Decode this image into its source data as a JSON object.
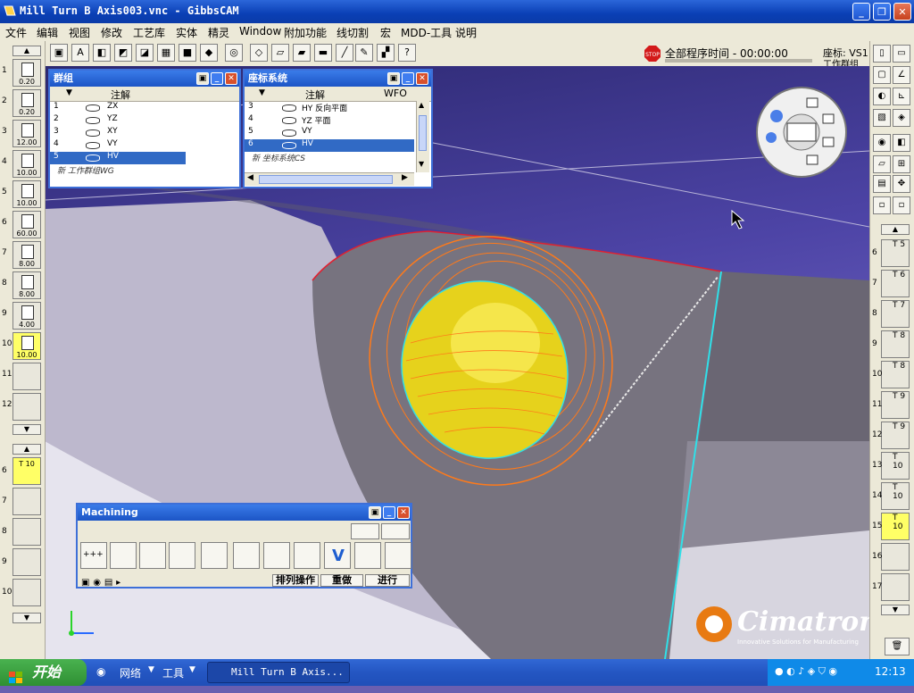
{
  "window": {
    "title": "Mill Turn B Axis003.vnc - GibbsCAM",
    "minimize": "_",
    "maximize": "❐",
    "close": "✕"
  },
  "menu": [
    "文件",
    "编辑",
    "视图",
    "修改",
    "工艺库",
    "实体",
    "精灵",
    "Window",
    "附加功能",
    "线切割",
    "宏",
    "MDD-工具",
    "说明"
  ],
  "toolbar": {
    "timer_label": "全部程序时间 - 00:00:00",
    "stop_label": "STOP",
    "coord_label": "座标: VS1",
    "group_label": "工作群组"
  },
  "left_tools": [
    {
      "num": "1",
      "value": "0.20"
    },
    {
      "num": "2",
      "value": "0.20"
    },
    {
      "num": "3",
      "value": "12.00"
    },
    {
      "num": "4",
      "value": "10.00"
    },
    {
      "num": "5",
      "value": "10.00"
    },
    {
      "num": "6",
      "value": "60.00"
    },
    {
      "num": "7",
      "value": "8.00"
    },
    {
      "num": "8",
      "value": "8.00"
    },
    {
      "num": "9",
      "value": "4.00"
    },
    {
      "num": "10",
      "value": "10.00"
    },
    {
      "num": "11",
      "value": ""
    },
    {
      "num": "12",
      "value": ""
    }
  ],
  "left_tools2": [
    {
      "num": "6",
      "value": "T 10"
    },
    {
      "num": "7",
      "value": ""
    },
    {
      "num": "8",
      "value": ""
    },
    {
      "num": "9",
      "value": ""
    },
    {
      "num": "10",
      "value": ""
    }
  ],
  "right_tools": [
    {
      "num": "6",
      "label": "T 5"
    },
    {
      "num": "7",
      "label": "T 6"
    },
    {
      "num": "8",
      "label": "T 7"
    },
    {
      "num": "9",
      "label": "T 8"
    },
    {
      "num": "10",
      "label": "T 8"
    },
    {
      "num": "11",
      "label": "T 9"
    },
    {
      "num": "12",
      "label": "T 9"
    },
    {
      "num": "13",
      "label": "T 10"
    },
    {
      "num": "14",
      "label": "T 10"
    },
    {
      "num": "15",
      "label": "T 10"
    },
    {
      "num": "16",
      "label": ""
    },
    {
      "num": "17",
      "label": ""
    }
  ],
  "group_panel": {
    "title": "群组",
    "header": "注解",
    "rows": [
      {
        "num": "1",
        "label": "ZX"
      },
      {
        "num": "2",
        "label": "YZ"
      },
      {
        "num": "3",
        "label": "XY"
      },
      {
        "num": "4",
        "label": "VY"
      },
      {
        "num": "5",
        "label": "HV"
      }
    ],
    "footer": "新 工作群组WG"
  },
  "coord_panel": {
    "title": "座标系统",
    "header": "注解",
    "header2": "WFO",
    "rows": [
      {
        "num": "3",
        "label": "HY 反向平面"
      },
      {
        "num": "4",
        "label": "YZ 平面"
      },
      {
        "num": "5",
        "label": "VY"
      },
      {
        "num": "6",
        "label": "HV"
      }
    ],
    "footer": "新 坐标系统CS"
  },
  "machining_panel": {
    "title": "Machining",
    "buttons": [
      "排列操作",
      "重做",
      "进行"
    ]
  },
  "taskbar": {
    "start": "开始",
    "network": "网络",
    "tools": "工具",
    "task_item": "Mill Turn B Axis...",
    "clock": "12:13"
  },
  "logo": {
    "brand": "Cimatron",
    "tagline": "Innovative Solutions for Manufacturing"
  }
}
